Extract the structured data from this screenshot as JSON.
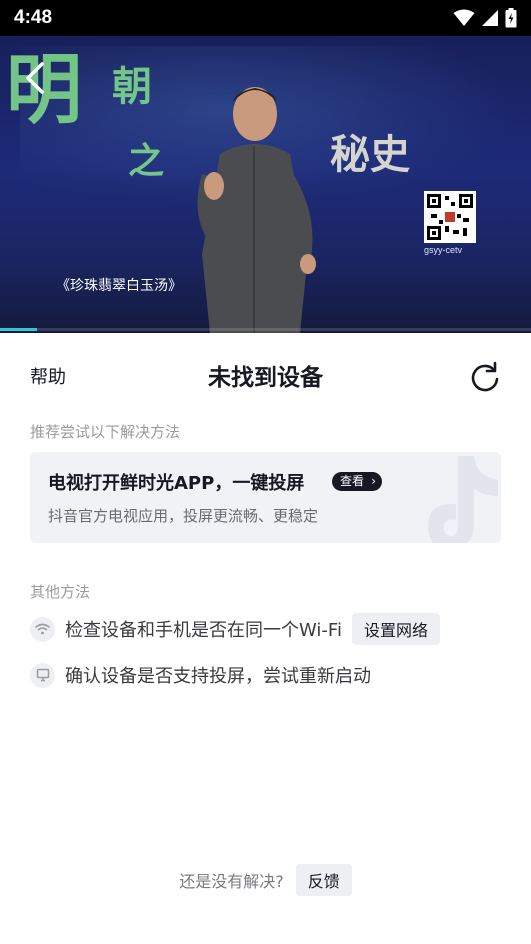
{
  "status_bar": {
    "time": "4:48",
    "icons": [
      "wifi-icon",
      "signal-icon",
      "battery-charging-icon"
    ]
  },
  "video": {
    "caption": "《珍珠翡翠白玉汤》",
    "calligraphy": [
      "明",
      "朝",
      "之",
      "秘史"
    ],
    "qr_label": "gsyy-cetv",
    "progress": 0.07,
    "accent_color": "#2ec8d0"
  },
  "sheet": {
    "help_label": "帮助",
    "title": "未找到设备",
    "recommended_label": "推荐尝试以下解决方法",
    "recommendation": {
      "title": "电视打开鲜时光APP，一键投屏",
      "view_label": "查看",
      "subtitle": "抖音官方电视应用，投屏更流畅、更稳定"
    },
    "other_label": "其他方法",
    "options": [
      {
        "icon": "wifi-icon",
        "text": "检查设备和手机是否在同一个Wi-Fi",
        "button": "设置网络"
      },
      {
        "icon": "monitor-icon",
        "text": "确认设备是否支持投屏，尝试重新启动"
      }
    ],
    "footer": {
      "text": "还是没有解决?",
      "feedback_label": "反馈"
    }
  }
}
